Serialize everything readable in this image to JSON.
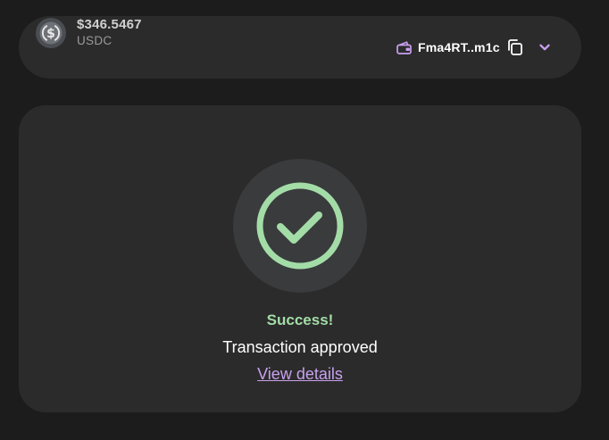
{
  "wallet": {
    "balance": "$346.5467",
    "token_symbol": "USDC",
    "token_icon": "usdc-dollar-icon",
    "address_short": "Fma4RT..m1c",
    "address_icon": "wallet-icon",
    "copy_icon": "copy-icon",
    "expand_icon": "chevron-down-icon"
  },
  "result": {
    "status_icon": "check-circle-icon",
    "title": "Success!",
    "message": "Transaction approved",
    "link_label": "View details"
  },
  "colors": {
    "background": "#1c1c1c",
    "card": "#2b2b2b",
    "success_green": "#a3dca7",
    "accent_purple": "#c8a0ee"
  }
}
